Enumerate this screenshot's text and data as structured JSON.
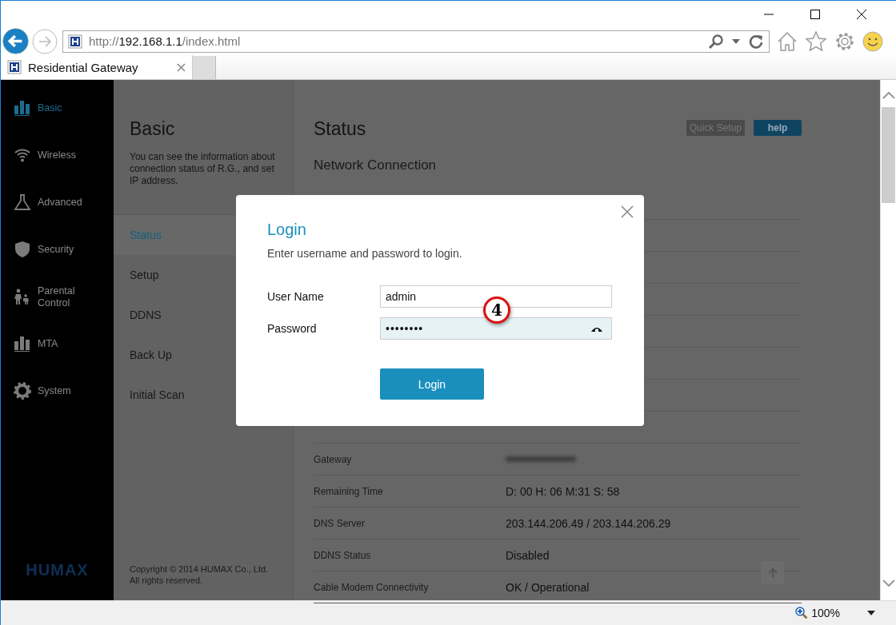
{
  "browser": {
    "address": {
      "prefix": "http://",
      "host": "192.168.1.1",
      "path": "/index.html"
    },
    "tabs": [
      {
        "title": "Residential Gateway",
        "selected": true
      }
    ],
    "zoom": "100%"
  },
  "sidebar": {
    "items": [
      {
        "label": "Basic",
        "selected": true
      },
      {
        "label": "Wireless",
        "selected": false
      },
      {
        "label": "Advanced",
        "selected": false
      },
      {
        "label": "Security",
        "selected": false
      },
      {
        "label": "Parental Control",
        "selected": false
      },
      {
        "label": "MTA",
        "selected": false
      },
      {
        "label": "System",
        "selected": false
      }
    ],
    "logo": "HUMAX"
  },
  "subnav": {
    "title": "Basic",
    "description": "You can see the information about connection status of R.G., and set IP address.",
    "items": [
      {
        "label": "Status",
        "selected": true
      },
      {
        "label": "Setup",
        "selected": false
      },
      {
        "label": "DDNS",
        "selected": false
      },
      {
        "label": "Back Up",
        "selected": false
      },
      {
        "label": "Initial Scan",
        "selected": false
      }
    ],
    "copyright": [
      "Copyright © 2014 HUMAX Co., Ltd.",
      "All rights reserved."
    ]
  },
  "main": {
    "title": "Status",
    "buttons": [
      {
        "label": "Quick Setup",
        "kind": "secondary"
      },
      {
        "label": "help",
        "kind": "primary"
      }
    ],
    "section": "Network Connection",
    "rows": [
      {
        "label": "Gateway",
        "kind": "redacted"
      },
      {
        "label": "Remaining Time",
        "value": "D: 00 H: 06 M:31 S: 58",
        "kind": "text"
      },
      {
        "label": "DNS Server",
        "value": "203.144.206.49 / 203.144.206.29",
        "kind": "text"
      },
      {
        "label": "DDNS Status",
        "value": "Disabled",
        "kind": "text"
      },
      {
        "label": "Cable Modem Connectivity",
        "value": "OK / Operational",
        "kind": "text"
      }
    ]
  },
  "dialog": {
    "title": "Login",
    "subtitle": "Enter username and password to login.",
    "fields": [
      {
        "label": "User Name",
        "value": "admin",
        "kind": "text",
        "focused": false
      },
      {
        "label": "Password",
        "value": "••••••••",
        "kind": "password",
        "focused": true
      }
    ],
    "submit": "Login",
    "step_badge": "4"
  }
}
